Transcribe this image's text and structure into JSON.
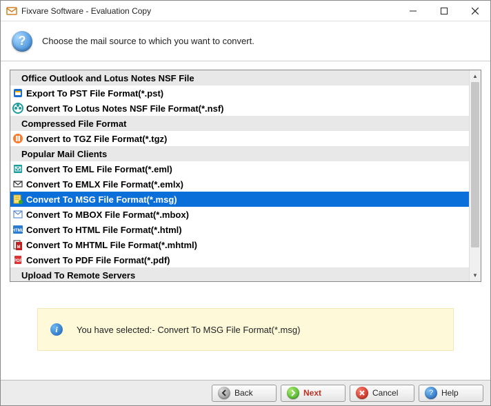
{
  "window": {
    "title": "Fixvare Software - Evaluation Copy"
  },
  "header": {
    "text": "Choose the mail source to which you want to convert."
  },
  "rows": [
    {
      "type": "category",
      "label": "Office Outlook and Lotus Notes NSF File"
    },
    {
      "type": "item",
      "label": "Export To PST File Format(*.pst)",
      "icon": "pst"
    },
    {
      "type": "item",
      "label": "Convert To Lotus Notes NSF File Format(*.nsf)",
      "icon": "nsf"
    },
    {
      "type": "category",
      "label": "Compressed File Format"
    },
    {
      "type": "item",
      "label": "Convert to TGZ File Format(*.tgz)",
      "icon": "tgz"
    },
    {
      "type": "category",
      "label": "Popular Mail Clients"
    },
    {
      "type": "item",
      "label": "Convert To EML File Format(*.eml)",
      "icon": "eml"
    },
    {
      "type": "item",
      "label": "Convert To EMLX File Format(*.emlx)",
      "icon": "emlx"
    },
    {
      "type": "item",
      "label": "Convert To MSG File Format(*.msg)",
      "icon": "msg",
      "selected": true
    },
    {
      "type": "item",
      "label": "Convert To MBOX File Format(*.mbox)",
      "icon": "mbox"
    },
    {
      "type": "item",
      "label": "Convert To HTML File Format(*.html)",
      "icon": "html"
    },
    {
      "type": "item",
      "label": "Convert To MHTML File Format(*.mhtml)",
      "icon": "mhtml"
    },
    {
      "type": "item",
      "label": "Convert To PDF File Format(*.pdf)",
      "icon": "pdf"
    },
    {
      "type": "category",
      "label": "Upload To Remote Servers"
    }
  ],
  "info": {
    "text": "You have selected:- Convert To MSG File Format(*.msg)"
  },
  "buttons": {
    "back": "Back",
    "next": "Next",
    "cancel": "Cancel",
    "help": "Help"
  }
}
